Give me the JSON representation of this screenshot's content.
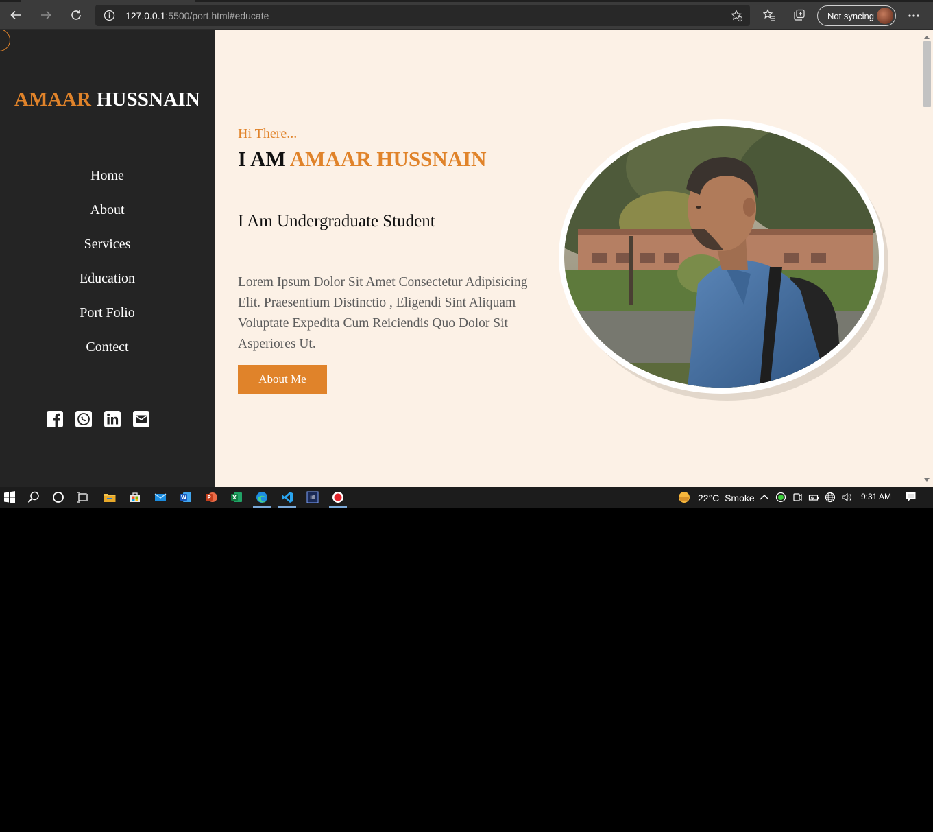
{
  "browser": {
    "url_host": "127.0.0.1",
    "url_rest": ":5500/port.html#educate",
    "sync_label": "Not syncing"
  },
  "sidebar": {
    "logo_first": "AMAAR",
    "logo_last": "HUSSNAIN",
    "nav": [
      {
        "label": "Home"
      },
      {
        "label": "About"
      },
      {
        "label": "Services"
      },
      {
        "label": "Education"
      },
      {
        "label": "Port Folio"
      },
      {
        "label": "Contect"
      }
    ],
    "socials": [
      "facebook-icon",
      "whatsapp-icon",
      "linkedin-icon",
      "email-icon"
    ]
  },
  "hero": {
    "greeting": "Hi There...",
    "iam_prefix": "I AM",
    "name": "AMAAR HUSSNAIN",
    "subtitle": "I Am Undergraduate Student",
    "paragraph": "Lorem Ipsum Dolor Sit Amet Consectetur Adipisicing Elit. Praesentium Distinctio , Eligendi Sint Aliquam Voluptate Expedita Cum Reiciendis Quo Dolor Sit Asperiores Ut.",
    "button_label": "About Me"
  },
  "taskbar": {
    "weather_temp": "22°C",
    "weather_desc": "Smoke",
    "time": "9:31 AM"
  },
  "colors": {
    "accent": "#e0832a",
    "sidebar_bg": "#242424",
    "page_bg": "#fcf1e6"
  }
}
